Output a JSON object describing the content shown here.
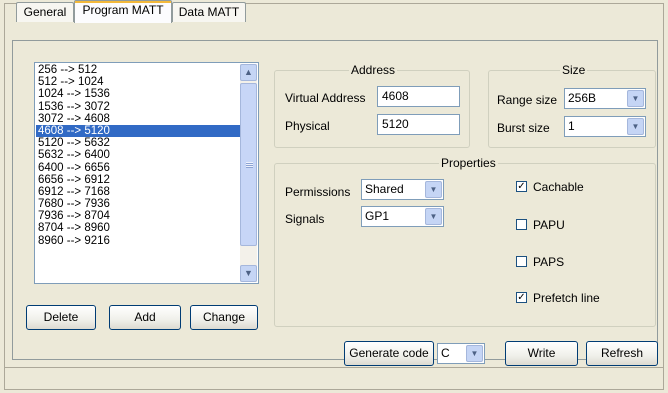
{
  "tabs": [
    {
      "label": "General",
      "active": false
    },
    {
      "label": "Program MATT",
      "active": true
    },
    {
      "label": "Data MATT",
      "active": false
    }
  ],
  "list": {
    "items": [
      "256 --> 512",
      "512 --> 1024",
      "1024 --> 1536",
      "1536 --> 3072",
      "3072 --> 4608",
      "4608 --> 5120",
      "5120 --> 5632",
      "5632 --> 6400",
      "6400 --> 6656",
      "6656 --> 6912",
      "6912 --> 7168",
      "7680 --> 7936",
      "7936 --> 8704",
      "8704 --> 8960",
      "8960 --> 9216"
    ],
    "selected_index": 5
  },
  "list_buttons": {
    "delete": "Delete",
    "add": "Add",
    "change": "Change"
  },
  "address": {
    "legend": "Address",
    "virtual_label": "Virtual Address",
    "virtual_value": "4608",
    "physical_label": "Physical",
    "physical_value": "5120"
  },
  "size": {
    "legend": "Size",
    "range_label": "Range size",
    "range_value": "256B",
    "burst_label": "Burst size",
    "burst_value": "1"
  },
  "properties": {
    "legend": "Properties",
    "permissions_label": "Permissions",
    "permissions_value": "Shared",
    "signals_label": "Signals",
    "signals_value": "GP1",
    "checkboxes": [
      {
        "label": "Cachable",
        "checked": true
      },
      {
        "label": "PAPU",
        "checked": false
      },
      {
        "label": "PAPS",
        "checked": false
      },
      {
        "label": "Prefetch line",
        "checked": true
      }
    ]
  },
  "footer": {
    "generate_label": "Generate code",
    "language_value": "C",
    "write_label": "Write",
    "refresh_label": "Refresh"
  },
  "icons": {
    "up": "scroll-up-arrow-icon",
    "down": "scroll-down-arrow-icon",
    "dropdown": "chevron-down-icon"
  },
  "colors": {
    "selection": "#316ac5",
    "tab_highlight": "#f3b93b",
    "dialog_bg": "#ece9d8"
  }
}
